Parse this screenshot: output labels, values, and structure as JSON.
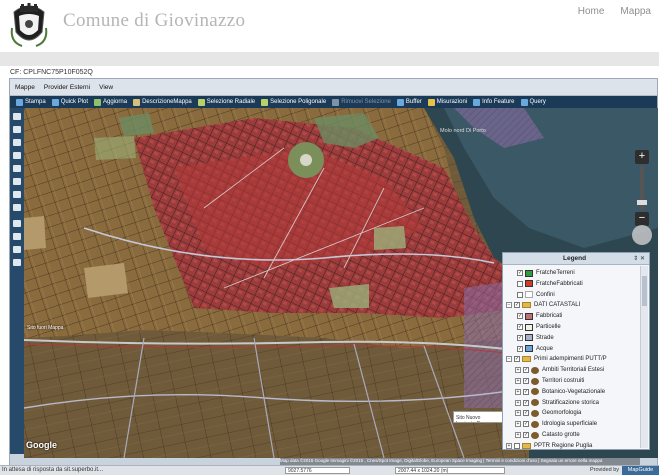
{
  "header": {
    "title": "Comune di Giovinazzo",
    "nav": [
      "Home",
      "Mappa"
    ]
  },
  "cf_label": "CF: CPLFNC75P10F052Q",
  "menubar": [
    "Mappe",
    "Provider Esterni",
    "View"
  ],
  "toolbar": [
    {
      "label": "Stampa",
      "icon": "print-icon",
      "color": "#6aa9de",
      "enabled": true
    },
    {
      "label": "Quick Plot",
      "icon": "plot-icon",
      "color": "#6aa9de",
      "enabled": true
    },
    {
      "label": "Aggiorna",
      "icon": "refresh-icon",
      "color": "#8fc16b",
      "enabled": true
    },
    {
      "label": "DescrizioneMappa",
      "icon": "description-icon",
      "color": "#d7c07a",
      "enabled": true
    },
    {
      "label": "Selezione Radiale",
      "icon": "radial-select-icon",
      "color": "#b8d06b",
      "enabled": true
    },
    {
      "label": "Selezione Poligonale",
      "icon": "polygon-select-icon",
      "color": "#b8d06b",
      "enabled": true
    },
    {
      "label": "Rimuovi Selezione",
      "icon": "clear-select-icon",
      "color": "#7f93a8",
      "enabled": false
    },
    {
      "label": "Buffer",
      "icon": "buffer-icon",
      "color": "#6aa9de",
      "enabled": true
    },
    {
      "label": "Misurazioni",
      "icon": "measure-icon",
      "color": "#e7c14a",
      "enabled": true
    },
    {
      "label": "Info Feature",
      "icon": "info-icon",
      "color": "#6aa9de",
      "enabled": true
    },
    {
      "label": "Query",
      "icon": "query-icon",
      "color": "#6aa9de",
      "enabled": true
    }
  ],
  "map": {
    "porto_label": "Molo nord Di Porto",
    "sign_label": "Sito fuori Mappa",
    "tooltip": "Sito Nuovo Impianto D...",
    "google_label": "Google",
    "attribution": "Map data ©2015 Google Immagini ©2015 , Cnes/Spot Image, DigitalGlobe, European Space Imaging | Termini e condizioni d'uso | Segnala un errore nella mappa"
  },
  "legend": {
    "title": "Legend",
    "items": [
      {
        "label": "FratcheTerreni",
        "type": "layer",
        "swatch": "#2e9e3a",
        "checked": true
      },
      {
        "label": "FratcheFabbricati",
        "type": "layer",
        "swatch": "#d43a2a",
        "checked": false
      },
      {
        "label": "Confini",
        "type": "layer",
        "swatch": "",
        "checked": false
      },
      {
        "label": "DATI CATASTALI",
        "type": "group",
        "checked": true
      },
      {
        "label": "Fabbricati",
        "type": "layer",
        "swatch": "#c0706e",
        "checked": true
      },
      {
        "label": "Particelle",
        "type": "layer",
        "swatch": "#f1f1e0",
        "checked": true
      },
      {
        "label": "Strade",
        "type": "layer",
        "swatch": "#a8b4c8",
        "checked": true
      },
      {
        "label": "Acque",
        "type": "layer",
        "swatch": "#6aa5dc",
        "checked": true
      },
      {
        "label": "Primi adempimenti PUTT/P",
        "type": "group",
        "checked": true
      },
      {
        "label": "Ambiti Territoriali Estesi",
        "type": "subgroup",
        "checked": true
      },
      {
        "label": "Territori costruiti",
        "type": "subgroup",
        "checked": true
      },
      {
        "label": "Botanico-Vegetazionale",
        "type": "subgroup",
        "checked": true
      },
      {
        "label": "Stratificazione storica",
        "type": "subgroup",
        "checked": true
      },
      {
        "label": "Geomorfologia",
        "type": "subgroup",
        "checked": true
      },
      {
        "label": "Idrologia superficiale",
        "type": "subgroup",
        "checked": true
      },
      {
        "label": "Catasto grotte",
        "type": "subgroup",
        "checked": true
      },
      {
        "label": "PPTR Regione Puglia",
        "type": "group",
        "checked": false
      }
    ]
  },
  "status": {
    "left": "In attesa di risposta da sit.superbo.it...",
    "coord1": "9027.5776",
    "coord2": "2007.44 x 1024.20 (m)",
    "provided_by": "Provided by",
    "brand": "MapGuide"
  }
}
